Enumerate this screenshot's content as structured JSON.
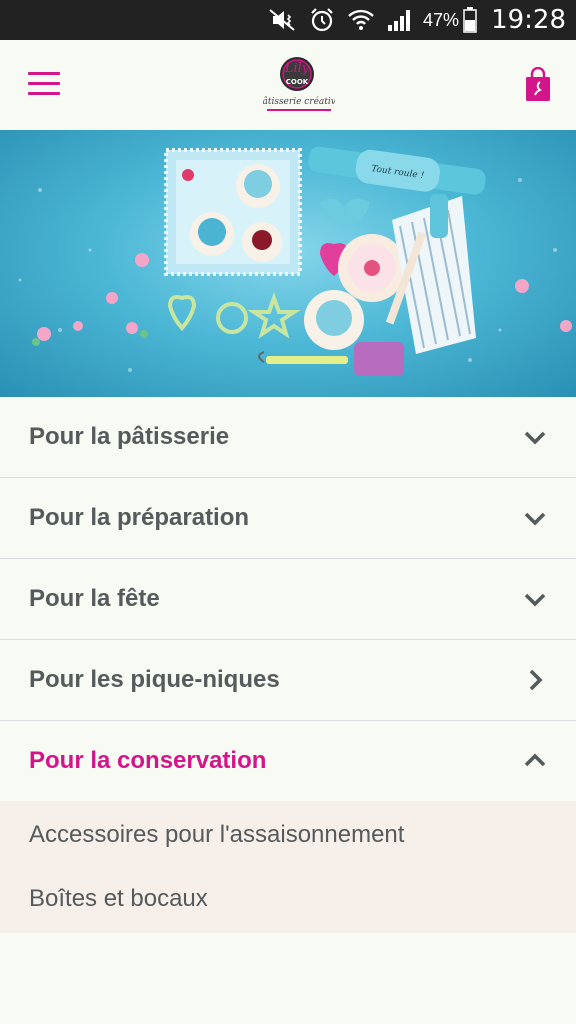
{
  "status_bar": {
    "battery_percent": "47%",
    "time": "19:28",
    "icons": [
      "mute-vibrate-icon",
      "alarm-icon",
      "wifi-icon",
      "signal-icon",
      "battery-icon"
    ]
  },
  "header": {
    "menu_icon": "hamburger-menu-icon",
    "logo_text": "Lilycook",
    "logo_tagline": "Pâtisserie créative",
    "cart_icon": "shopping-bag-icon"
  },
  "hero": {
    "rolling_pin_text": "Tout roule !"
  },
  "menu": {
    "items": [
      {
        "label": "Pour la pâtisserie",
        "state": "collapsed"
      },
      {
        "label": "Pour la préparation",
        "state": "collapsed"
      },
      {
        "label": "Pour la fête",
        "state": "collapsed"
      },
      {
        "label": "Pour les pique-niques",
        "state": "link"
      },
      {
        "label": "Pour la conservation",
        "state": "expanded"
      }
    ],
    "submenu": [
      {
        "label": "Accessoires pour l'assaisonnement"
      },
      {
        "label": "Boîtes et bocaux"
      }
    ]
  },
  "colors": {
    "accent": "#d4148a",
    "text": "#555a5c",
    "background": "#f7fbf3",
    "submenu_background": "#f6efea",
    "status_bar": "#222222"
  }
}
